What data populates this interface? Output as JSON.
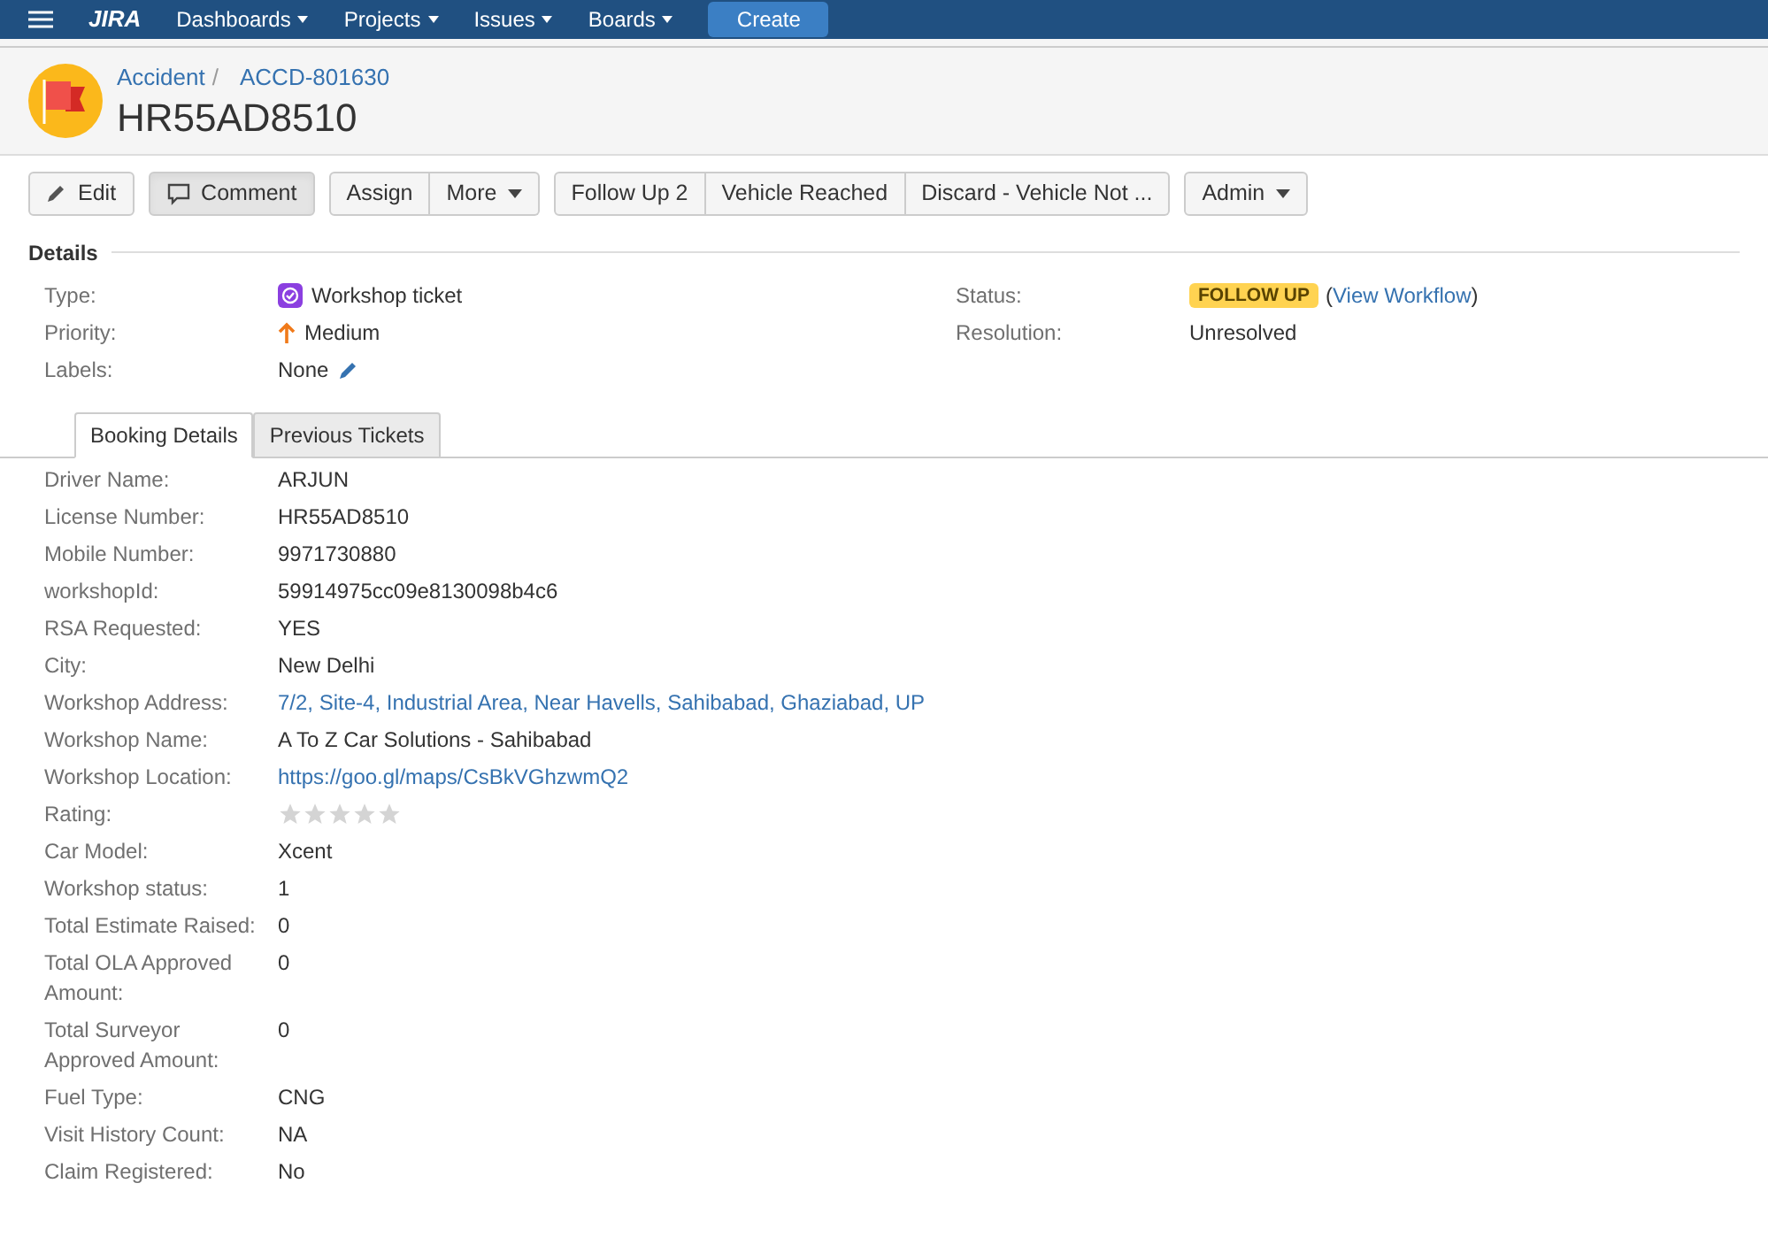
{
  "nav": {
    "logo": "JIRA",
    "items": [
      {
        "label": "Dashboards"
      },
      {
        "label": "Projects"
      },
      {
        "label": "Issues"
      },
      {
        "label": "Boards"
      }
    ],
    "create": "Create"
  },
  "header": {
    "breadcrumbs": [
      "Accident",
      "ACCD-801630"
    ],
    "separator": "/",
    "title": "HR55AD8510"
  },
  "toolbar": {
    "groups": [
      [
        {
          "label": "Edit",
          "kind": "edit",
          "selected": false
        }
      ],
      [
        {
          "label": "Comment",
          "kind": "comment",
          "selected": true
        }
      ],
      [
        {
          "label": "Assign",
          "kind": "plain",
          "selected": false
        },
        {
          "label": "More",
          "kind": "dropdown",
          "selected": false
        }
      ],
      [
        {
          "label": "Follow Up 2",
          "kind": "plain",
          "selected": false
        },
        {
          "label": "Vehicle Reached",
          "kind": "plain",
          "selected": false
        },
        {
          "label": "Discard - Vehicle Not ...",
          "kind": "plain",
          "selected": false
        }
      ],
      [
        {
          "label": "Admin",
          "kind": "dropdown",
          "selected": false
        }
      ]
    ]
  },
  "details": {
    "heading": "Details",
    "left": [
      {
        "label": "Type:",
        "value": "Workshop ticket",
        "kind": "type"
      },
      {
        "label": "Priority:",
        "value": "Medium",
        "kind": "priority"
      },
      {
        "label": "Labels:",
        "value": "None",
        "kind": "labels"
      }
    ],
    "status": {
      "label": "Status:",
      "badge": "FOLLOW UP",
      "link": "View Workflow",
      "open": "(",
      "close": ")"
    },
    "resolution": {
      "label": "Resolution:",
      "value": "Unresolved"
    }
  },
  "tabs": [
    {
      "label": "Booking Details",
      "selected": true
    },
    {
      "label": "Previous Tickets",
      "selected": false
    }
  ],
  "fields": [
    {
      "label": "Driver Name:",
      "value": "ARJUN",
      "kind": "text"
    },
    {
      "label": "License Number:",
      "value": "HR55AD8510",
      "kind": "text"
    },
    {
      "label": "Mobile Number:",
      "value": "9971730880",
      "kind": "text"
    },
    {
      "label": "workshopId:",
      "value": "59914975cc09e8130098b4c6",
      "kind": "text"
    },
    {
      "label": "RSA Requested:",
      "value": "YES",
      "kind": "text"
    },
    {
      "label": "City:",
      "value": "New Delhi",
      "kind": "text"
    },
    {
      "label": "Workshop Address:",
      "value": "7/2, Site-4, Industrial Area, Near Havells, Sahibabad, Ghaziabad, UP",
      "kind": "link"
    },
    {
      "label": "Workshop Name:",
      "value": "A To Z Car Solutions - Sahibabad",
      "kind": "text"
    },
    {
      "label": "Workshop Location:",
      "value": "https://goo.gl/maps/CsBkVGhzwmQ2",
      "kind": "link"
    },
    {
      "label": "Rating:",
      "stars": 0,
      "kind": "rating"
    },
    {
      "label": "Car Model:",
      "value": "Xcent",
      "kind": "text"
    },
    {
      "label": "Workshop status:",
      "value": "1",
      "kind": "text"
    },
    {
      "label": "Total Estimate Raised:",
      "value": "0",
      "kind": "text"
    },
    {
      "label": "Total OLA Approved Amount:",
      "value": "0",
      "kind": "text"
    },
    {
      "label": "Total Surveyor Approved Amount:",
      "value": "0",
      "kind": "text"
    },
    {
      "label": "Fuel Type:",
      "value": "CNG",
      "kind": "text"
    },
    {
      "label": "Visit History Count:",
      "value": "NA",
      "kind": "text"
    },
    {
      "label": "Claim Registered:",
      "value": "No",
      "kind": "text"
    }
  ]
}
